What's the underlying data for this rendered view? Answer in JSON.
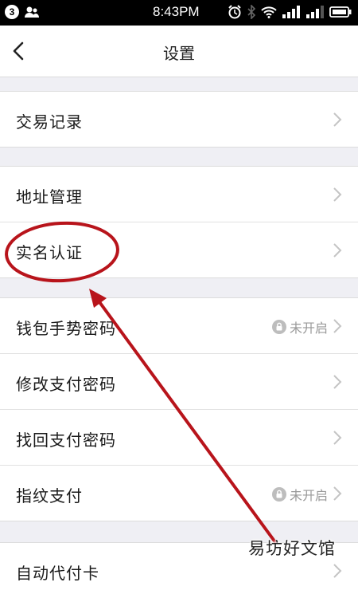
{
  "status_bar": {
    "notification_count": "3",
    "time": "8:43PM"
  },
  "header": {
    "title": "设置",
    "back_icon": "chevron-left-icon"
  },
  "groups": [
    {
      "rows": [
        {
          "label": "交易记录"
        }
      ]
    },
    {
      "rows": [
        {
          "label": "地址管理"
        },
        {
          "label": "实名认证"
        }
      ]
    },
    {
      "rows": [
        {
          "label": "钱包手势密码",
          "status": "未开启"
        },
        {
          "label": "修改支付密码"
        },
        {
          "label": "找回支付密码"
        },
        {
          "label": "指纹支付",
          "status": "未开启"
        }
      ]
    },
    {
      "rows": [
        {
          "label": "自动代付卡"
        }
      ]
    }
  ],
  "annotation": {
    "highlight_color": "#b8141b",
    "highlighted_item": "实名认证"
  },
  "watermark": "易坊好文馆"
}
